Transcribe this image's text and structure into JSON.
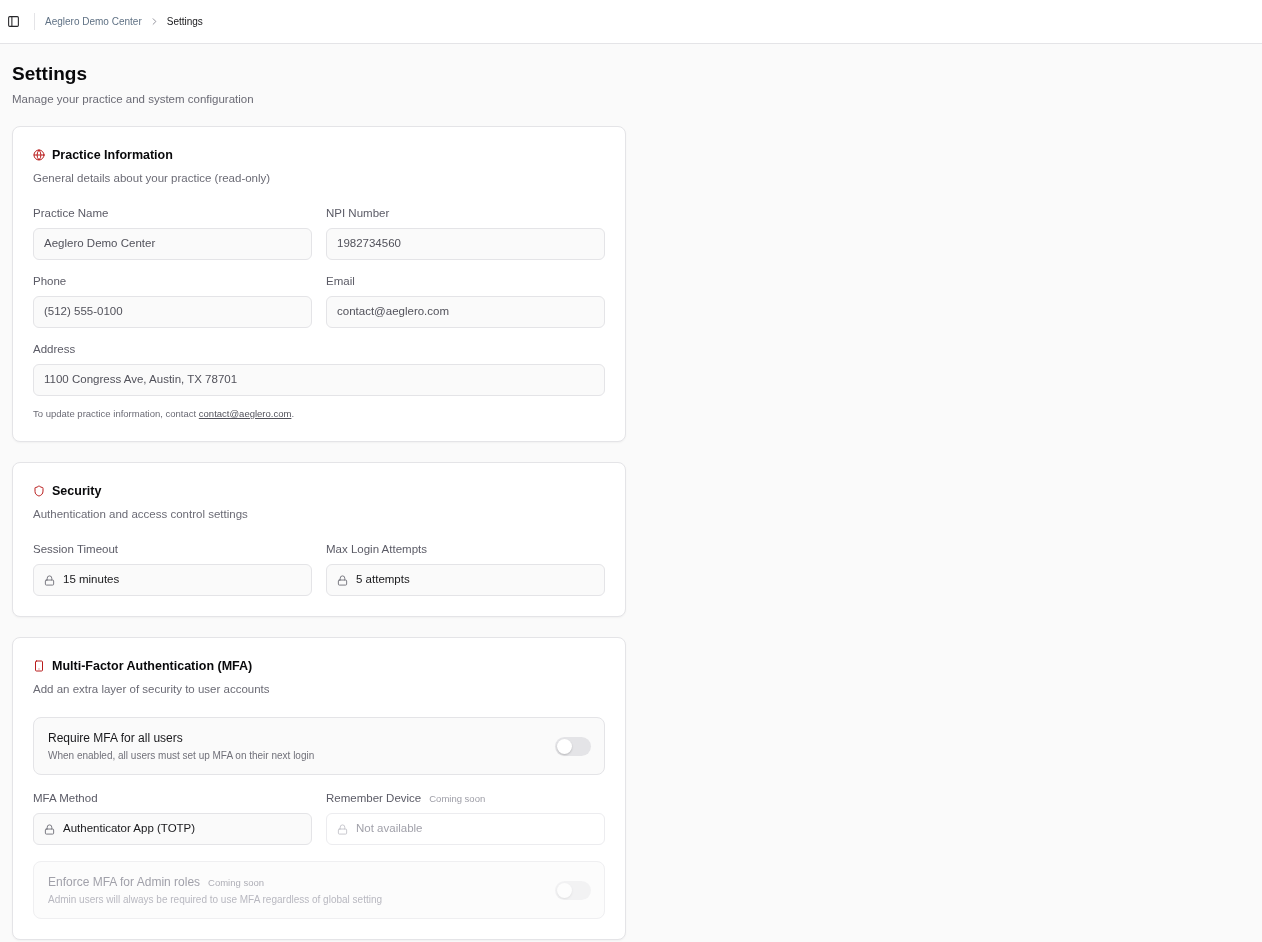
{
  "top_bar": {
    "breadcrumbs": [
      {
        "label": "Aeglero Demo Center",
        "current": false
      },
      {
        "label": "Settings",
        "current": true
      }
    ]
  },
  "header": {
    "title": "Settings",
    "subtitle": "Manage your practice and system configuration"
  },
  "sections": [
    {
      "title": "Practice Information",
      "description": "General details about your practice (read-only)",
      "blocks": [
        {
          "kind": "fields",
          "fields": [
            {
              "label": "Practice Name",
              "value": "Aeglero Demo Center",
              "locked": false,
              "disabled": false
            },
            {
              "label": "NPI Number",
              "value": "1982734560",
              "locked": false,
              "disabled": false
            }
          ]
        },
        {
          "kind": "fields",
          "fields": [
            {
              "label": "Phone",
              "value": "(512) 555-0100",
              "locked": false,
              "disabled": false
            },
            {
              "label": "Email",
              "value": "contact@aeglero.com",
              "locked": false,
              "disabled": false
            }
          ]
        },
        {
          "kind": "fields",
          "fields": [
            {
              "label": "Address",
              "value": "1100 Congress Ave, Austin, TX 78701",
              "locked": false,
              "disabled": false
            }
          ]
        },
        {
          "kind": "note",
          "text": "To update practice information, contact ",
          "link": "contact@aeglero.com",
          "text_after": "."
        }
      ]
    },
    {
      "title": "Security",
      "description": "Authentication and access control settings",
      "blocks": [
        {
          "kind": "fields",
          "fields": [
            {
              "label": "Session Timeout",
              "value": "15 minutes",
              "locked": true,
              "disabled": false
            },
            {
              "label": "Max Login Attempts",
              "value": "5 attempts",
              "locked": true,
              "disabled": false
            }
          ]
        }
      ]
    },
    {
      "title": "Multi-Factor Authentication (MFA)",
      "description": "Add an extra layer of security to user accounts",
      "blocks": [
        {
          "kind": "toggle",
          "title": "Require MFA for all users",
          "description": "When enabled, all users must set up MFA on their next login",
          "on": false,
          "disabled": false
        },
        {
          "kind": "fields",
          "fields": [
            {
              "label": "MFA Method",
              "value": "Authenticator App (TOTP)",
              "locked": true,
              "disabled": false
            },
            {
              "label": "Remember Device",
              "badge": "Coming soon",
              "value": "Not available",
              "locked": true,
              "disabled": true
            }
          ]
        },
        {
          "kind": "toggle",
          "title": "Enforce MFA for Admin roles",
          "badge": "Coming soon",
          "description": "Admin users will always be required to use MFA regardless of global setting",
          "on": false,
          "disabled": true
        }
      ]
    }
  ]
}
